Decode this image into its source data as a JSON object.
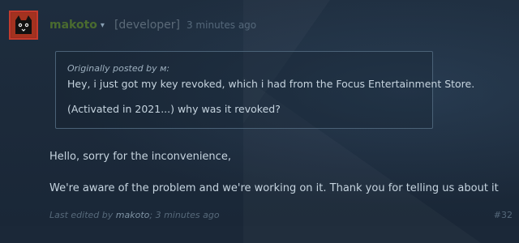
{
  "post": {
    "author": {
      "name": "makoto",
      "role": "[developer]",
      "time": "3 minutes ago",
      "avatar_icon": "black-cat-icon"
    },
    "quote": {
      "prefix": "Originally posted by ",
      "author": "м",
      "suffix": ":",
      "line1": "Hey, i just got my key revoked, which i had from the Focus Entertainment Store.",
      "line2": "(Activated in 2021...) why was it revoked?"
    },
    "body": {
      "line1": "Hello, sorry for the inconvenience,",
      "line2": "We're aware of the problem and we're working on it. Thank you for telling us about it"
    },
    "edit": {
      "prefix": "Last edited by ",
      "editor": "makoto",
      "suffix": "; 3 minutes ago"
    },
    "number": "#32"
  },
  "colors": {
    "background": "#1b2838",
    "author": "#4a6b2f",
    "text": "#c6d4df",
    "muted": "#56697a",
    "quote_border": "#4b6277"
  }
}
